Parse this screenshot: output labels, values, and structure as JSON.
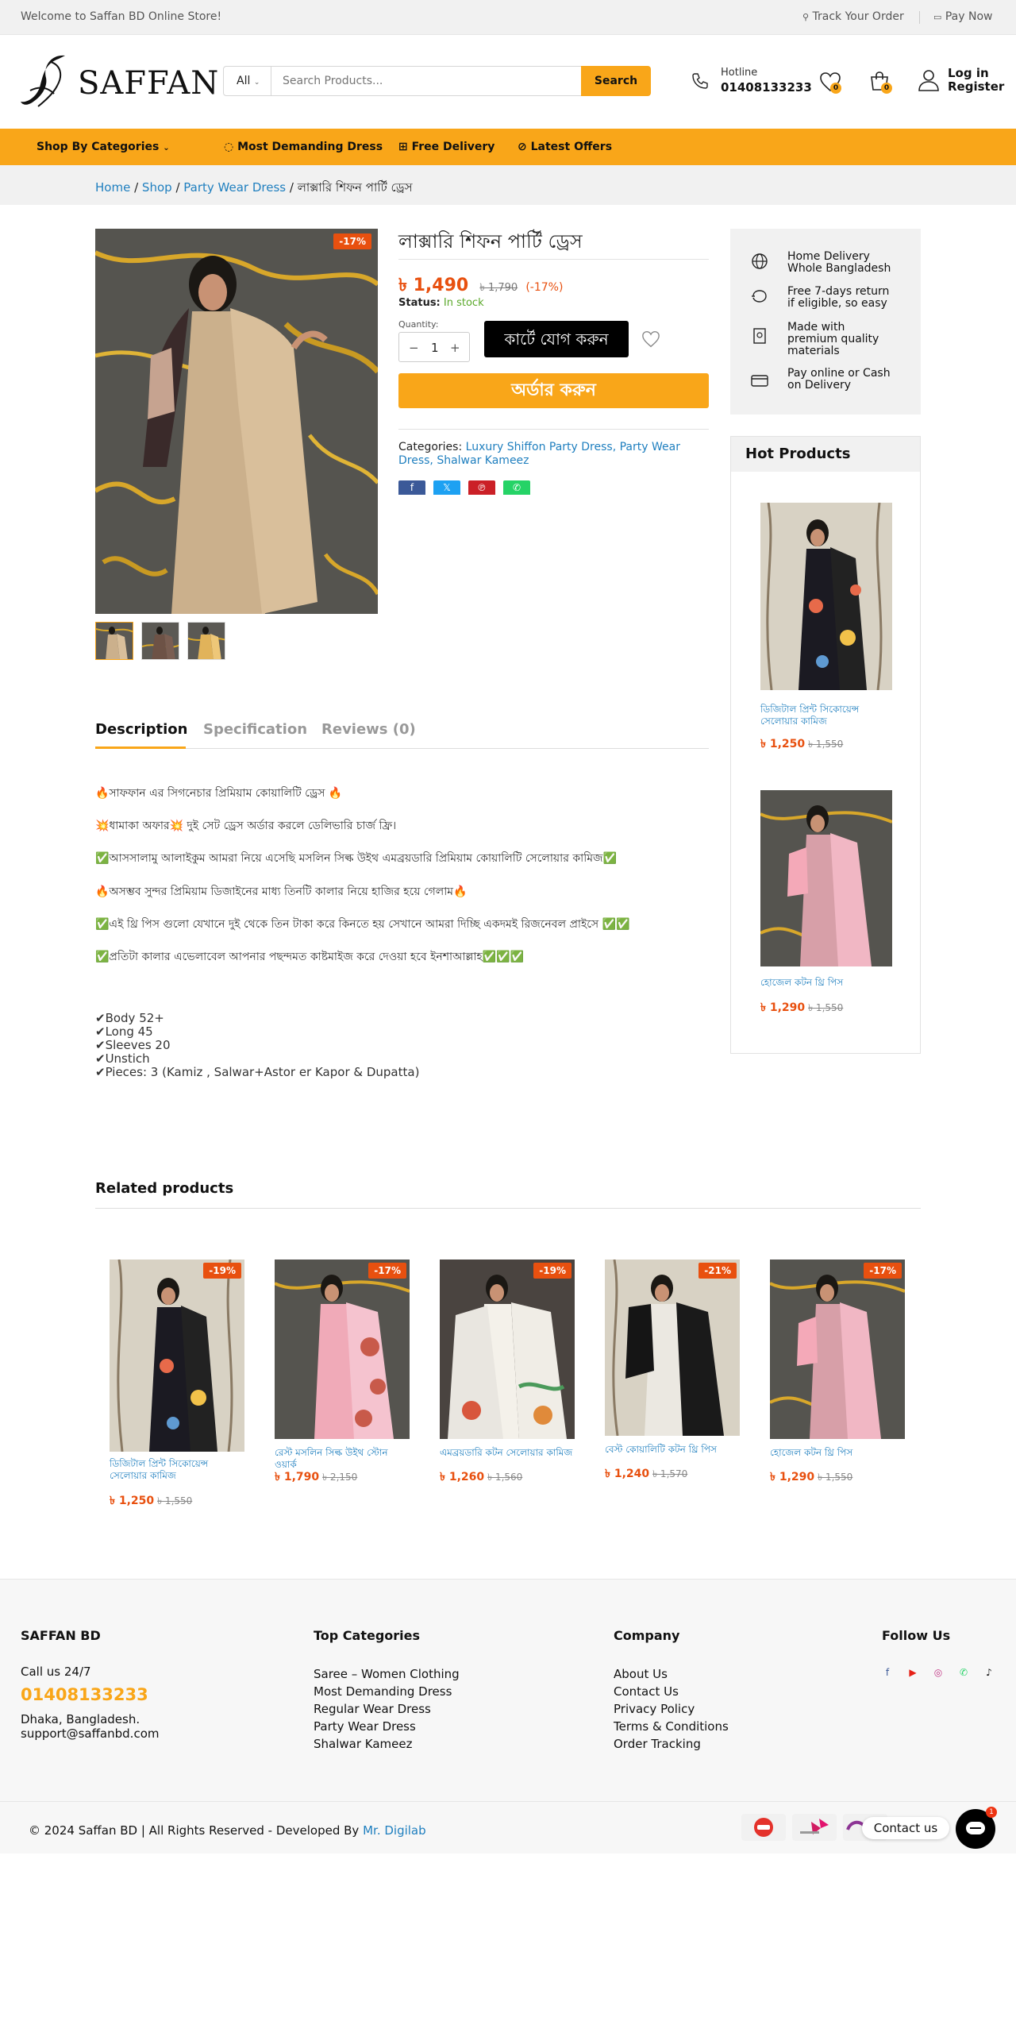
{
  "topbar": {
    "welcome": "Welcome to Saffan BD Online Store!",
    "track_order": "Track Your Order",
    "pay_now": "Pay Now"
  },
  "header": {
    "logo_text": "SAFFAN",
    "search": {
      "category": "All",
      "placeholder": "Search Products...",
      "button": "Search"
    },
    "hotline_label": "Hotline",
    "hotline_number": "01408133233",
    "wishlist_count": "0",
    "cart_count": "0",
    "login": "Log in",
    "register": "Register"
  },
  "nav": {
    "categories": "Shop By Categories",
    "items": [
      "Most Demanding Dress",
      "Free Delivery",
      "Latest Offers"
    ]
  },
  "breadcrumb": {
    "items": [
      "Home",
      "Shop",
      "Party Wear Dress"
    ],
    "current": "লাক্সারি শিফন পার্টি ড্রেস",
    "sep": "/"
  },
  "product": {
    "sale_badge": "-17%",
    "title": "লাক্সারি শিফন পার্টি ড্রেস",
    "price": "৳ 1,490",
    "old_price": "৳ 1,790",
    "discount": "(-17%)",
    "status_label": "Status:",
    "status_value": "In stock",
    "quantity_label": "Quantity:",
    "quantity": "1",
    "add_to_cart": "কার্টে যোগ করুন",
    "order_now": "অর্ডার করুন",
    "categories_label": "Categories:",
    "categories": "Luxury Shiffon Party Dress, Party Wear Dress, Shalwar Kameez"
  },
  "features": [
    "Home Delivery Whole Bangladesh",
    "Free 7-days return if eligible, so easy",
    "Made with premium quality materials",
    "Pay online or Cash on Delivery"
  ],
  "hot_products": {
    "title": "Hot Products",
    "items": [
      {
        "name": "ডিজিটাল প্রিন্ট সিকোয়েন্স সেলোয়ার কামিজ",
        "price": "৳ 1,250",
        "old_price": "৳ 1,550"
      },
      {
        "name": "হোজেল কটন থ্রি পিস",
        "price": "৳ 1,290",
        "old_price": "৳ 1,550"
      }
    ]
  },
  "tabs": [
    "Description",
    "Specification",
    "Reviews (0)"
  ],
  "description": {
    "lines": [
      "🔥সাফফান এর সিগনেচার প্রিমিয়াম কোয়ালিটি ড্রেস 🔥",
      "💥ধামাকা অফার💥 দুই সেট ড্রেস অর্ডার করলে ডেলিভারি চার্জ ফ্রি।",
      "✅আসসালামু আলাইকুম আমরা নিয়ে এসেছি মসলিন সিল্ক উইথ এমব্রয়ডারি প্রিমিয়াম কোয়ালিটি সেলোয়ার কামিজ✅",
      "🔥অসম্ভব সুন্দর প্রিমিয়াম ডিজাইনের মাধ্য তিনটি কালার নিয়ে হাজির হয়ে গেলাম🔥",
      "✅এই থ্রি পিস গুলো যেখানে দুই থেকে তিন টাকা করে কিনতে হয় সেখানে আমরা দিচ্ছি একদমই রিজনেবল প্রাইসে ✅✅",
      "✅প্রতিটা কালার এভেলাবেল আপনার পছন্দমত কাষ্টমাইজ করে দেওয়া হবে ইনশাআল্লাহ✅✅✅"
    ],
    "specs": [
      "✔Body 52+",
      "✔Long 45",
      "✔Sleeves 20",
      "✔Unstich",
      "✔Pieces: 3 (Kamiz , Salwar+Astor er Kapor & Dupatta)"
    ]
  },
  "related": {
    "title": "Related products",
    "items": [
      {
        "badge": "-19%",
        "name": "ডিজিটাল প্রিন্ট সিকোয়েন্স সেলোয়ার কামিজ",
        "price": "৳ 1,250",
        "old_price": "৳ 1,550"
      },
      {
        "badge": "-17%",
        "name": "রেস্ট মসলিন সিল্ক উইথ স্টোন ওয়ার্ক",
        "price": "৳ 1,790",
        "old_price": "৳ 2,150"
      },
      {
        "badge": "-19%",
        "name": "এমব্রয়ডারি কটন সেলোয়ার কামিজ",
        "price": "৳ 1,260",
        "old_price": "৳ 1,560"
      },
      {
        "badge": "-21%",
        "name": "বেস্ট কোয়ালিটি কটন থ্রি পিস",
        "price": "৳ 1,240",
        "old_price": "৳ 1,570"
      },
      {
        "badge": "-17%",
        "name": "হোজেল কটন থ্রি পিস",
        "price": "৳ 1,290",
        "old_price": "৳ 1,550"
      }
    ]
  },
  "footer": {
    "brand": "SAFFAN BD",
    "call_label": "Call us 24/7",
    "phone": "01408133233",
    "address": "Dhaka, Bangladesh.",
    "email": "support@saffanbd.com",
    "top_categories_title": "Top Categories",
    "top_categories": [
      "Saree – Women Clothing",
      "Most Demanding Dress",
      "Regular Wear Dress",
      "Party Wear Dress",
      "Shalwar Kameez"
    ],
    "company_title": "Company",
    "company": [
      "About Us",
      "Contact Us",
      "Privacy Policy",
      "Terms & Conditions",
      "Order Tracking"
    ],
    "follow_title": "Follow Us",
    "copyright": "© 2024 Saffan BD | All Rights Reserved - Developed By",
    "developer": "Mr. Digilab",
    "contact_us": "Contact us",
    "chat_badge": "1"
  },
  "colors": {
    "accent": "#f9a619",
    "sale": "#e8500f",
    "link": "#1f7fbf",
    "in_stock": "#5aa82a"
  }
}
